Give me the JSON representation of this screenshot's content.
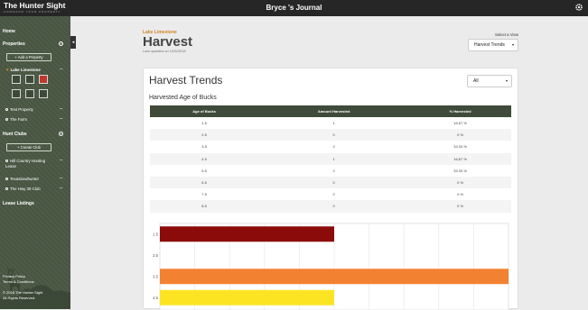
{
  "header": {
    "brand": "The Hunter Sight",
    "tagline": "COMMAND YOUR PROPERTY",
    "title": "Bryce 's Journal"
  },
  "sidebar": {
    "home": "Home",
    "properties": "Properties",
    "add_property": "+ Add a Property",
    "selected_property": "Lake Limestone",
    "properties_list": [
      "Test Property",
      "The Farm"
    ],
    "hunt_clubs": "Hunt Clubs",
    "create_club": "+ Create Club",
    "clubs": [
      "Hill Country Hunting Lease",
      "Texasbowhunter",
      "The Hwy 39 Club"
    ],
    "lease_listings": "Lease Listings",
    "privacy": "Privacy Policy",
    "terms": "Terms & Conditions",
    "copyright_line1": "© 2018 The Hunter Sight",
    "copyright_line2": "All Rights Reserved."
  },
  "page": {
    "property": "Lake Limestone",
    "title": "Harvest",
    "updated": "Last updated on 10/6/2018"
  },
  "view": {
    "label": "Select a View",
    "selected": "Harvest Trends"
  },
  "card": {
    "title": "Harvest Trends",
    "filter": "All",
    "subtitle": "Harvested Age of Bucks",
    "columns": [
      "Age of Bucks",
      "Amount Harvested",
      "% Harvested"
    ],
    "rows": [
      [
        "1.5",
        "1",
        "16.67 %"
      ],
      [
        "2.5",
        "0",
        "0 %"
      ],
      [
        "3.5",
        "2",
        "33.33 %"
      ],
      [
        "4.5",
        "1",
        "16.67 %"
      ],
      [
        "5.5",
        "2",
        "33.33 %"
      ],
      [
        "6.5",
        "0",
        "0 %"
      ],
      [
        "7.5",
        "0",
        "0 %"
      ],
      [
        "8.5",
        "0",
        "0 %"
      ]
    ]
  },
  "chart_data": {
    "type": "bar",
    "orientation": "horizontal",
    "categories": [
      "1.5",
      "2.5",
      "3.5",
      "4.5"
    ],
    "values": [
      1,
      0,
      2,
      1
    ],
    "colors": [
      "#8b0a0a",
      "#999999",
      "#f28132",
      "#fce424"
    ],
    "xlim": [
      0,
      2
    ],
    "grid": true
  },
  "colors": {
    "sidebar": "#4a5844",
    "table_header": "#3f4a3b",
    "accent": "#d2862a"
  }
}
